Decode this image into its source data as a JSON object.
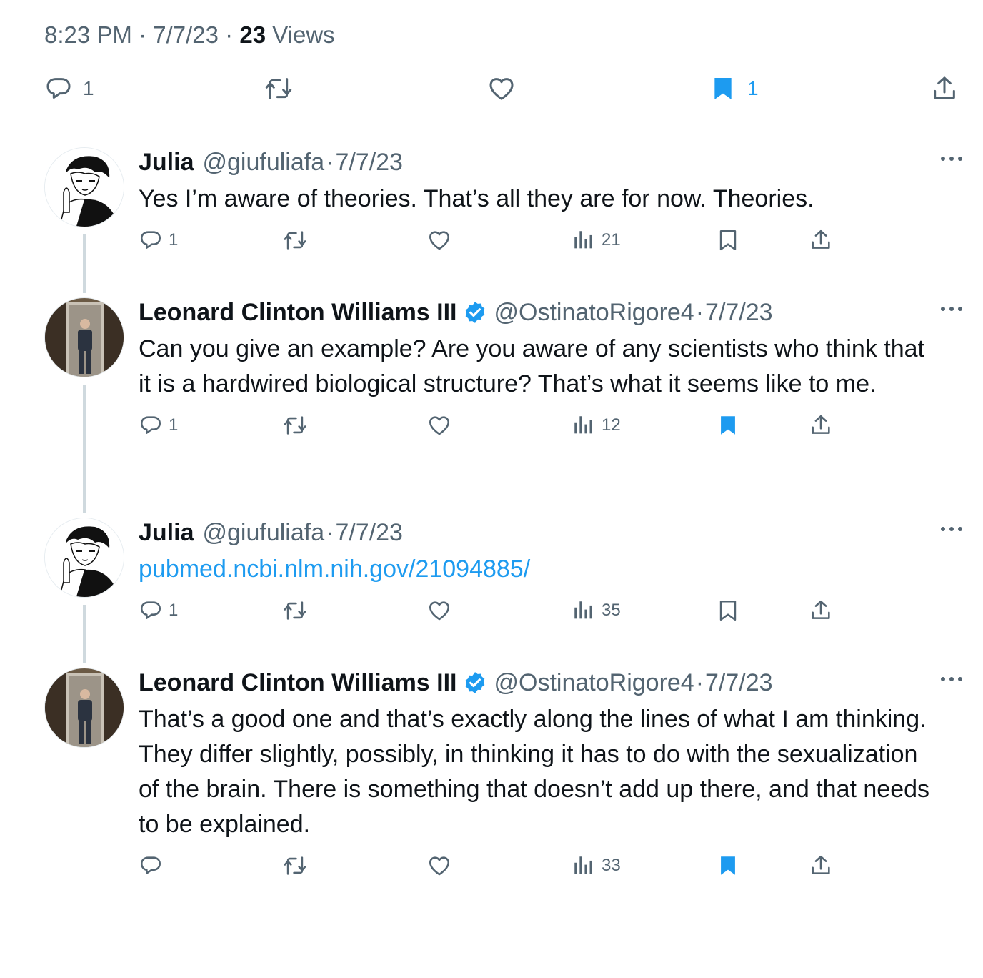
{
  "focused": {
    "time": "8:23 PM",
    "date": "7/7/23",
    "views_count": "23",
    "views_label": "Views",
    "reply_count": "1",
    "bookmark_count": "1"
  },
  "tweets": [
    {
      "name": "Julia",
      "handle": "@giufuliafa",
      "date": "7/7/23",
      "text": "Yes I’m aware of theories. That’s all they are for now. Theories.",
      "replies": "1",
      "views": "21"
    },
    {
      "name": "Leonard Clinton Williams III",
      "handle": "@OstinatoRigore4",
      "date": "7/7/23",
      "text": "Can you give an example? Are you aware of any scientists who think that it is a hardwired biological structure? That’s what it seems like to me.",
      "replies": "1",
      "views": "12"
    },
    {
      "name": "Julia",
      "handle": "@giufuliafa",
      "date": "7/7/23",
      "text": "pubmed.ncbi.nlm.nih.gov/21094885/",
      "replies": "1",
      "views": "35"
    },
    {
      "name": "Leonard Clinton Williams III",
      "handle": "@OstinatoRigore4",
      "date": "7/7/23",
      "text": "That’s a good one and that’s exactly along the lines of what I am thinking. They differ slightly, possibly, in thinking it has to do with the sexualization of the brain. There is something that doesn’t add up there, and that needs to be explained.",
      "replies": "",
      "views": "33"
    }
  ],
  "separator": "·",
  "colors": {
    "accent": "#1d9bf0",
    "secondary": "#536471",
    "text": "#0f1419",
    "divider": "#cfd9de"
  }
}
